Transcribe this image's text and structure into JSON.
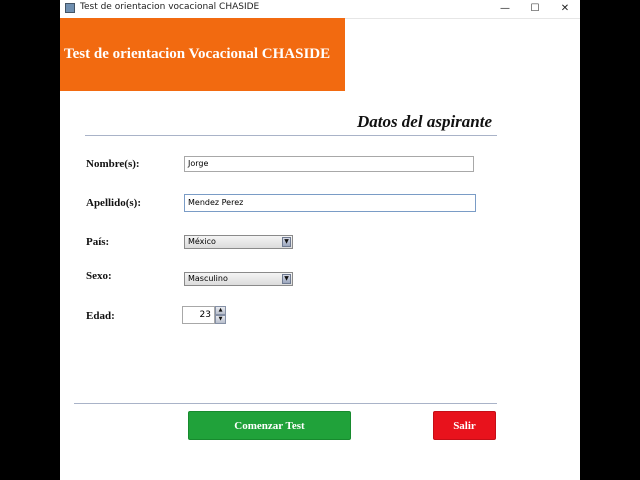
{
  "window": {
    "title": "Test de orientacion vocacional CHASIDE",
    "controls": {
      "minimize_icon": "—",
      "maximize_icon": "☐",
      "close_icon": "✕"
    }
  },
  "header": {
    "title": "Test de orientacion Vocacional CHASIDE",
    "color": "#f26a10"
  },
  "section": {
    "title": "Datos del aspirante"
  },
  "form": {
    "nombre": {
      "label": "Nombre(s):",
      "value": "Jorge"
    },
    "apellido": {
      "label": "Apellido(s):",
      "value": "Mendez Perez"
    },
    "pais": {
      "label": "País:",
      "value": "México"
    },
    "sexo": {
      "label": "Sexo:",
      "value": "Masculino"
    },
    "edad": {
      "label": "Edad:",
      "value": "23"
    }
  },
  "buttons": {
    "start": {
      "label": "Comenzar Test",
      "color": "#20a23a"
    },
    "exit": {
      "label": "Salir",
      "color": "#e8121c"
    }
  }
}
